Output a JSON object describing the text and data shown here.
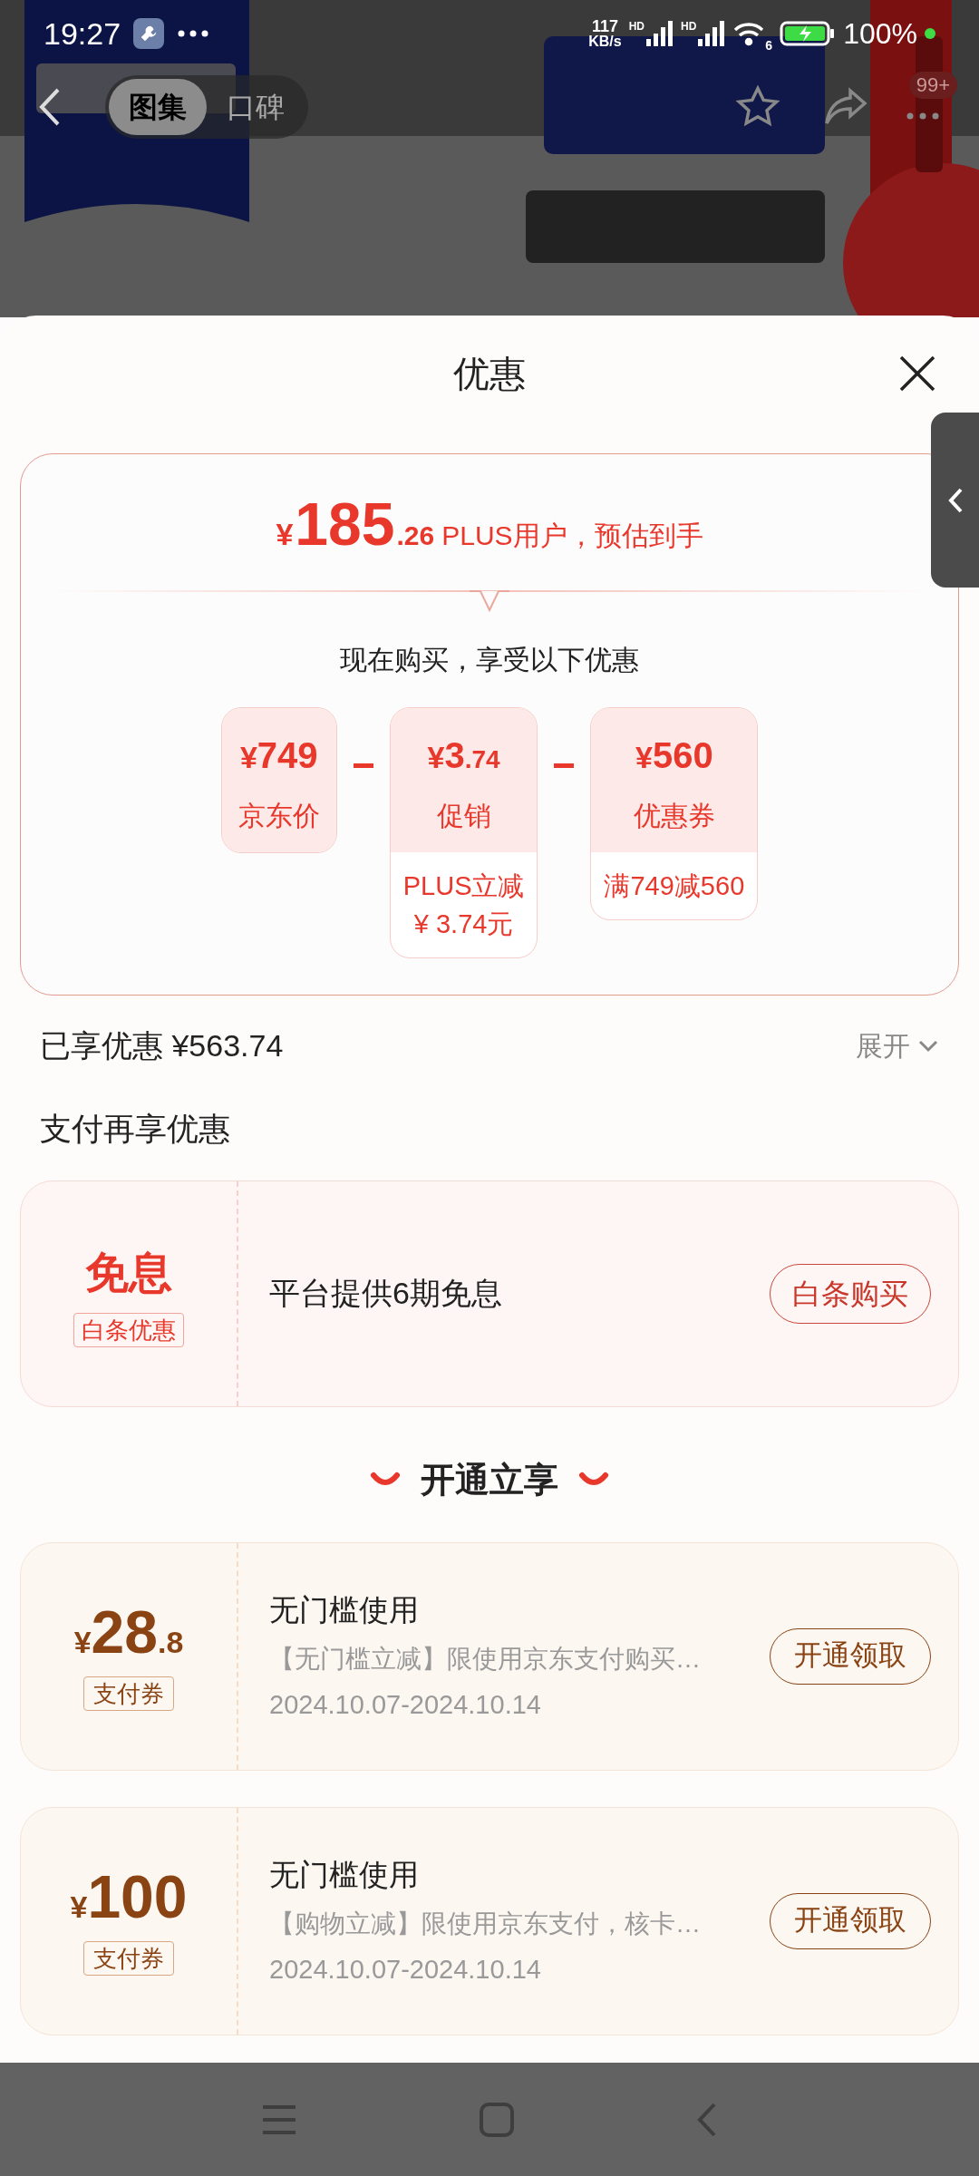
{
  "status_bar": {
    "time": "19:27",
    "speed_value": "117",
    "speed_unit": "KB/s",
    "signal_labels": [
      "HD",
      "HD"
    ],
    "wifi_label": "6",
    "battery": "100%"
  },
  "nav": {
    "tabs": [
      {
        "label": "图集",
        "selected": true
      },
      {
        "label": "口碑",
        "selected": false
      }
    ],
    "badge": "99+"
  },
  "sheet": {
    "title": "优惠"
  },
  "summary": {
    "symbol": "¥",
    "integer": "185",
    "decimal": ".26",
    "note": "PLUS用户，预估到手",
    "subtitle": "现在购买，享受以下优惠",
    "items": [
      {
        "symbol": "¥",
        "integer": "749",
        "label": "京东价"
      },
      {
        "symbol": "¥",
        "integer": "3",
        "decimal": ".74",
        "label": "促销",
        "detail": [
          "PLUS立减",
          "¥ 3.74元"
        ]
      },
      {
        "symbol": "¥",
        "integer": "560",
        "label": "优惠券",
        "detail": [
          "满749减560"
        ]
      }
    ]
  },
  "saved": {
    "text": "已享优惠 ¥563.74",
    "toggle": "展开",
    "expanded": false
  },
  "pay_section": {
    "title": "支付再享优惠",
    "card": {
      "headline": "免息",
      "tag": "白条优惠",
      "text": "平台提供6期免息",
      "button": "白条购买"
    }
  },
  "open_section": {
    "title": "开通立享",
    "coupons": [
      {
        "symbol": "¥",
        "integer": "28",
        "decimal": ".8",
        "tag": "支付券",
        "title": "无门槛使用",
        "desc": "【无门槛立减】限使用京东支付购买…",
        "dates": "2024.10.07-2024.10.14",
        "button": "开通领取"
      },
      {
        "symbol": "¥",
        "integer": "100",
        "tag": "支付券",
        "title": "无门槛使用",
        "desc": "【购物立减】限使用京东支付，核卡…",
        "dates": "2024.10.07-2024.10.14",
        "button": "开通领取"
      }
    ]
  }
}
